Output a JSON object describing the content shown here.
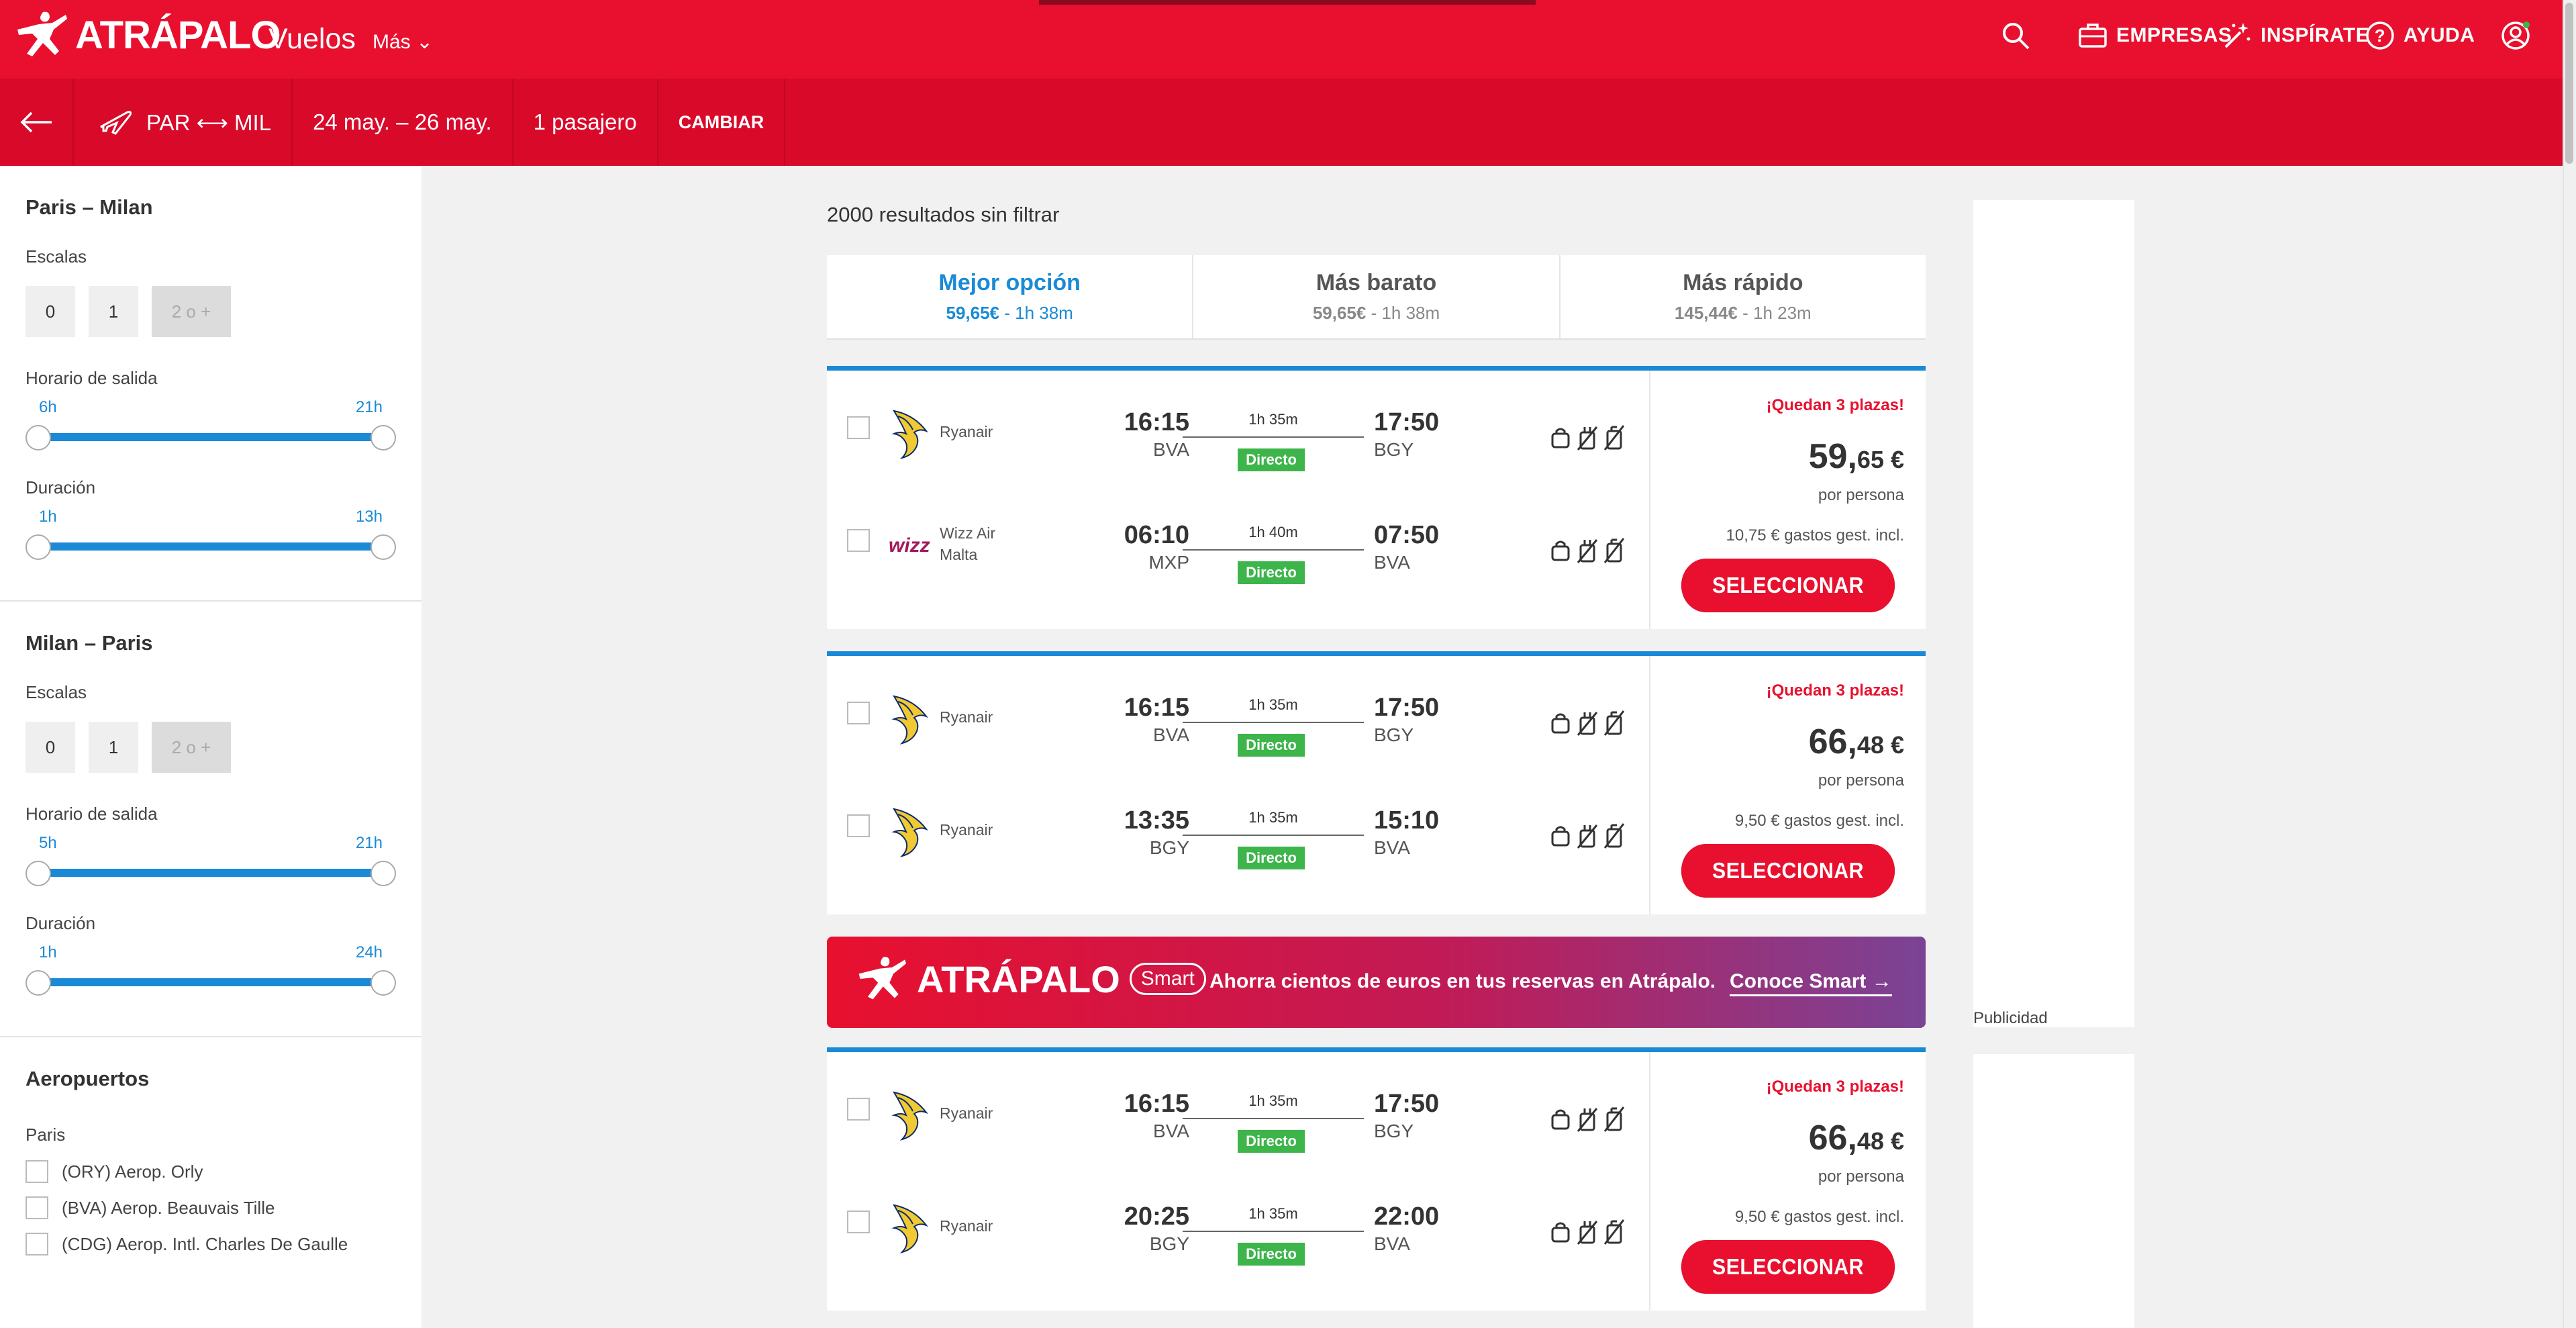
{
  "brand": {
    "name": "ATRÁPALO",
    "accent": "#e8102e",
    "blue": "#1a8ad6",
    "green": "#3db54a"
  },
  "topnav": {
    "section": "Vuelos",
    "more": "Más",
    "empresas": "EMPRESAS",
    "inspirate": "INSPÍRATE",
    "ayuda": "AYUDA",
    "icons": [
      "search-icon",
      "briefcase-icon",
      "magic-wand-icon",
      "help-icon",
      "user-icon"
    ]
  },
  "searchbar": {
    "route": "PAR ⟷ MIL",
    "dates": "24 may. – 26 may.",
    "passengers": "1 pasajero",
    "change": "CAMBIAR"
  },
  "filters": {
    "outbound": {
      "title": "Paris – Milan",
      "stops_label": "Escalas",
      "stops": [
        "0",
        "1",
        "2 o +"
      ],
      "departure_label": "Horario de salida",
      "departure_min": "6h",
      "departure_max": "21h",
      "duration_label": "Duración",
      "duration_min": "1h",
      "duration_max": "13h"
    },
    "inbound": {
      "title": "Milan – Paris",
      "stops_label": "Escalas",
      "stops": [
        "0",
        "1",
        "2 o +"
      ],
      "departure_label": "Horario de salida",
      "departure_min": "5h",
      "departure_max": "21h",
      "duration_label": "Duración",
      "duration_min": "1h",
      "duration_max": "24h"
    },
    "airports": {
      "title": "Aeropuertos",
      "city": "Paris",
      "items": [
        "(ORY) Aerop. Orly",
        "(BVA) Aerop. Beauvais Tille",
        "(CDG) Aerop. Intl. Charles De Gaulle"
      ]
    }
  },
  "results": {
    "count": "2000 resultados sin filtrar",
    "sort": [
      {
        "title": "Mejor opción",
        "price": "59,65€",
        "duration": " - 1h 38m"
      },
      {
        "title": "Más barato",
        "price": "59,65€",
        "duration": " - 1h 38m"
      },
      {
        "title": "Más rápido",
        "price": "145,44€",
        "duration": " - 1h 23m"
      }
    ],
    "cards": [
      {
        "scarcity": "¡Quedan 3 plazas!",
        "price_int": "59,",
        "price_dec": "65 €",
        "per_person": "por persona",
        "fees": "10,75 € gastos gest. incl.",
        "select": "SELECCIONAR",
        "legs": [
          {
            "airline": "Ryanair",
            "dep_time": "16:15",
            "dep_ap": "BVA",
            "duration": "1h 35m",
            "type": "Directo",
            "arr_time": "17:50",
            "arr_ap": "BGY"
          },
          {
            "airline": "Wizz Air Malta",
            "dep_time": "06:10",
            "dep_ap": "MXP",
            "duration": "1h 40m",
            "type": "Directo",
            "arr_time": "07:50",
            "arr_ap": "BVA"
          }
        ]
      },
      {
        "scarcity": "¡Quedan 3 plazas!",
        "price_int": "66,",
        "price_dec": "48 €",
        "per_person": "por persona",
        "fees": "9,50 € gastos gest. incl.",
        "select": "SELECCIONAR",
        "legs": [
          {
            "airline": "Ryanair",
            "dep_time": "16:15",
            "dep_ap": "BVA",
            "duration": "1h 35m",
            "type": "Directo",
            "arr_time": "17:50",
            "arr_ap": "BGY"
          },
          {
            "airline": "Ryanair",
            "dep_time": "13:35",
            "dep_ap": "BGY",
            "duration": "1h 35m",
            "type": "Directo",
            "arr_time": "15:10",
            "arr_ap": "BVA"
          }
        ]
      },
      {
        "scarcity": "¡Quedan 3 plazas!",
        "price_int": "66,",
        "price_dec": "48 €",
        "per_person": "por persona",
        "fees": "9,50 € gastos gest. incl.",
        "select": "SELECCIONAR",
        "legs": [
          {
            "airline": "Ryanair",
            "dep_time": "16:15",
            "dep_ap": "BVA",
            "duration": "1h 35m",
            "type": "Directo",
            "arr_time": "17:50",
            "arr_ap": "BGY"
          },
          {
            "airline": "Ryanair",
            "dep_time": "20:25",
            "dep_ap": "BGY",
            "duration": "1h 35m",
            "type": "Directo",
            "arr_time": "22:00",
            "arr_ap": "BVA"
          }
        ]
      }
    ]
  },
  "banner": {
    "logo": "ATRÁPALO",
    "badge": "Smart",
    "text": "Ahorra cientos de euros en tus reservas en Atrápalo.",
    "cta": "Conoce Smart →"
  },
  "ads": {
    "label": "Publicidad"
  }
}
